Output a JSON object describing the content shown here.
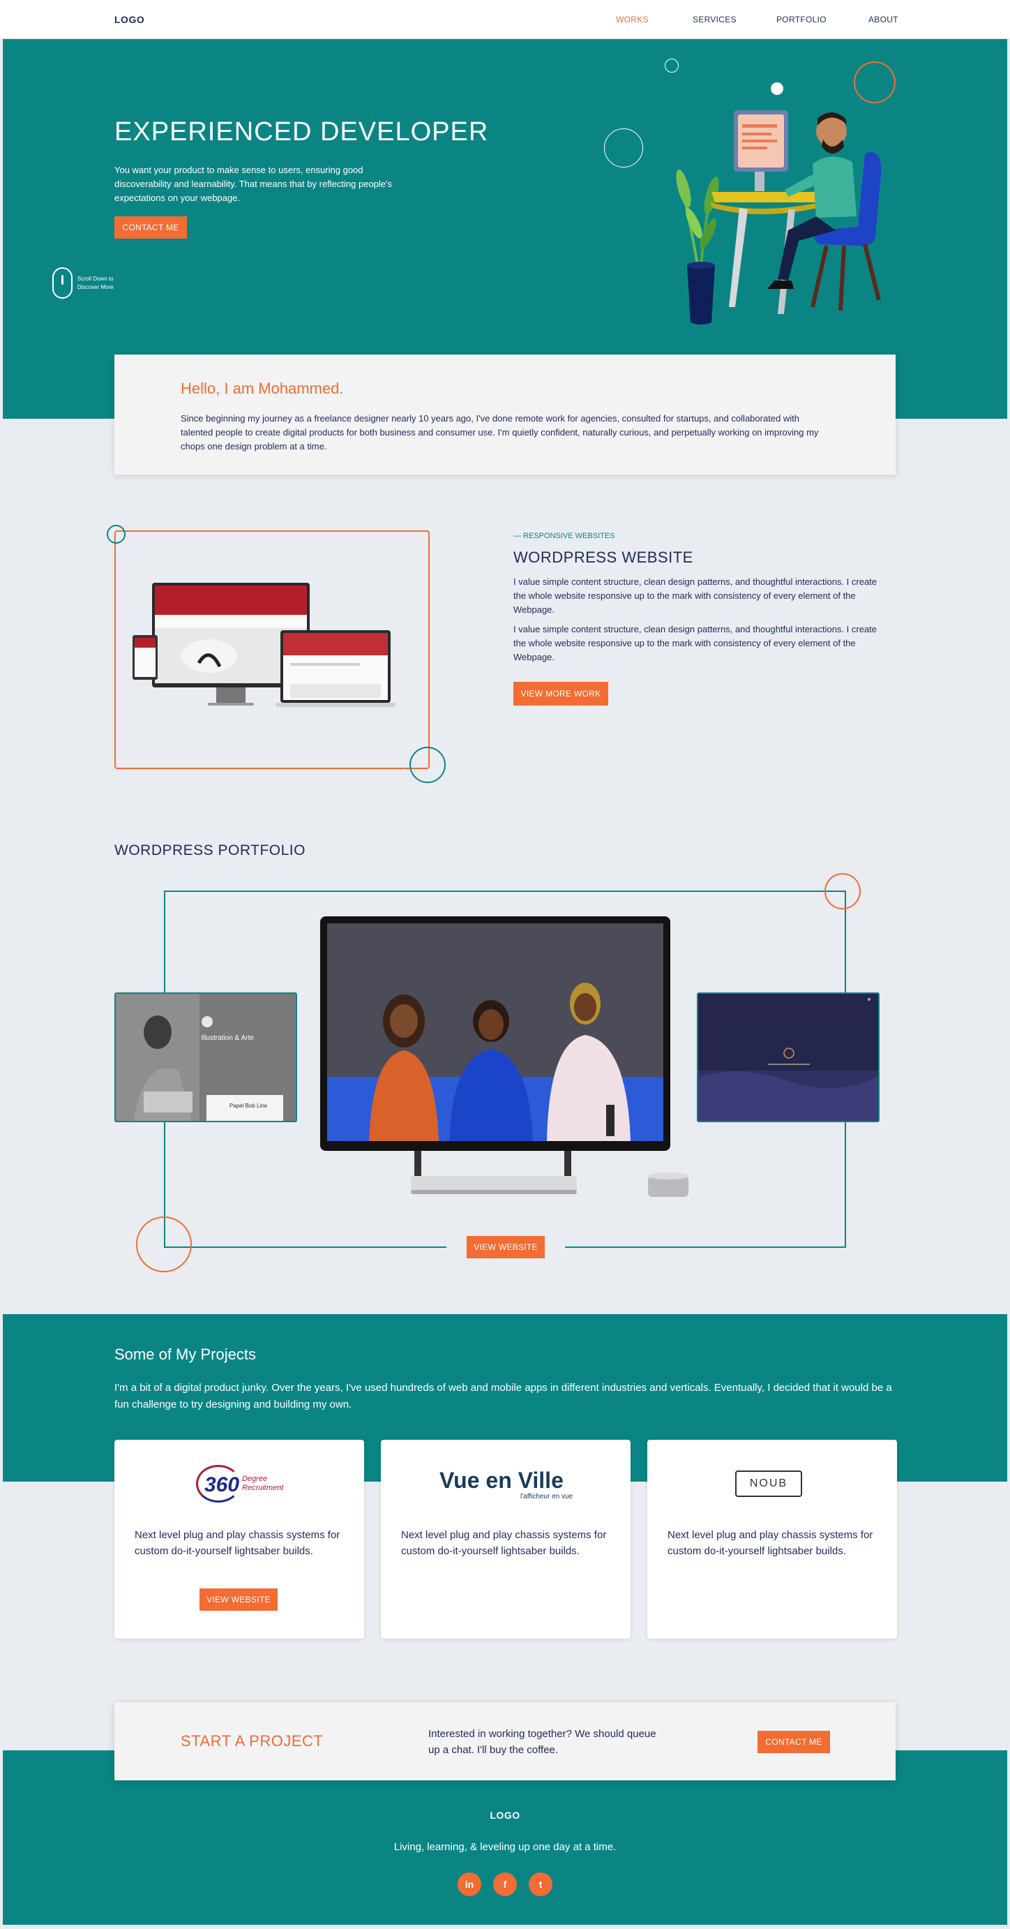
{
  "nav": {
    "logo": "LOGO",
    "items": [
      {
        "label": "WORKS",
        "active": true
      },
      {
        "label": "SERVICES",
        "active": false
      },
      {
        "label": "PORTFOLIO",
        "active": false
      },
      {
        "label": "ABOUT",
        "active": false
      }
    ]
  },
  "hero": {
    "title": "EXPERIENCED DEVELOPER",
    "text": "You want your product to make sense to users, ensuring good discoverability and learnability. That means that by reflecting people's expectations on your webpage.",
    "button": "CONTACT ME",
    "scroll_hint_line1": "Scroll Down to",
    "scroll_hint_line2": "Discover More",
    "illustration_icon": "developer-at-desk-illustration"
  },
  "about": {
    "title": "Hello, I am Mohammed.",
    "text": "Since beginning my journey as a freelance designer nearly 10 years ago, I've done remote work for agencies, consulted for startups, and collaborated with talented people to create digital products for both business and consumer use. I'm quietly confident, naturally curious, and perpetually working on improving my chops one design problem at a time."
  },
  "responsive": {
    "eyebrow": "— RESPONSIVE WEBSITES",
    "title": "WORDPRESS WEBSITE",
    "paragraphs": [
      "I value simple content structure, clean design patterns, and thoughtful interactions. I create the whole website responsive up to the mark with consistency of every element of the Webpage.",
      "I value simple content structure, clean design patterns, and thoughtful interactions. I create the whole website responsive up to the mark with consistency of every element of the Webpage."
    ],
    "button": "VIEW MORE WORK"
  },
  "portfolio": {
    "title": "WORDPRESS PORTFOLIO",
    "button": "VIEW WEBSITE",
    "left_thumb_caption": "Illustration & Arte",
    "left_thumb_card": "Papel Bob Line"
  },
  "projects": {
    "title": "Some of My Projects",
    "text": "I'm a bit of a digital product junky. Over the years, I've used hundreds of web and mobile apps in different industries and verticals. Eventually, I decided that it would be a fun challenge to try designing and building my own.",
    "cards": [
      {
        "logo_main": "360",
        "logo_sub1": "Degree",
        "logo_sub2": "Recruitment",
        "text": "Next level plug and play chassis systems for custom do-it-yourself lightsaber builds.",
        "button": "VIEW WEBSITE"
      },
      {
        "logo_main": "Vue en Ville",
        "logo_sub1": "l'afficheur en vue",
        "text": "Next level plug and play chassis systems for custom do-it-yourself lightsaber builds."
      },
      {
        "logo_main": "NOUB",
        "text": "Next level plug and play chassis systems for custom do-it-yourself lightsaber builds."
      }
    ]
  },
  "start": {
    "title": "START A PROJECT",
    "text": "Interested in working together? We should queue up a chat. I'll buy the coffee.",
    "button": "CONTACT ME"
  },
  "footer": {
    "logo": "LOGO",
    "tagline": "Living, learning, & leveling up one day at a time.",
    "social": [
      {
        "icon": "linkedin-icon",
        "glyph": "in"
      },
      {
        "icon": "facebook-icon",
        "glyph": "f"
      },
      {
        "icon": "twitter-icon",
        "glyph": "t"
      }
    ]
  },
  "colors": {
    "teal": "#0a8584",
    "orange": "#f26c33",
    "navy": "#1f2b5a",
    "background": "#e9ecf1"
  }
}
